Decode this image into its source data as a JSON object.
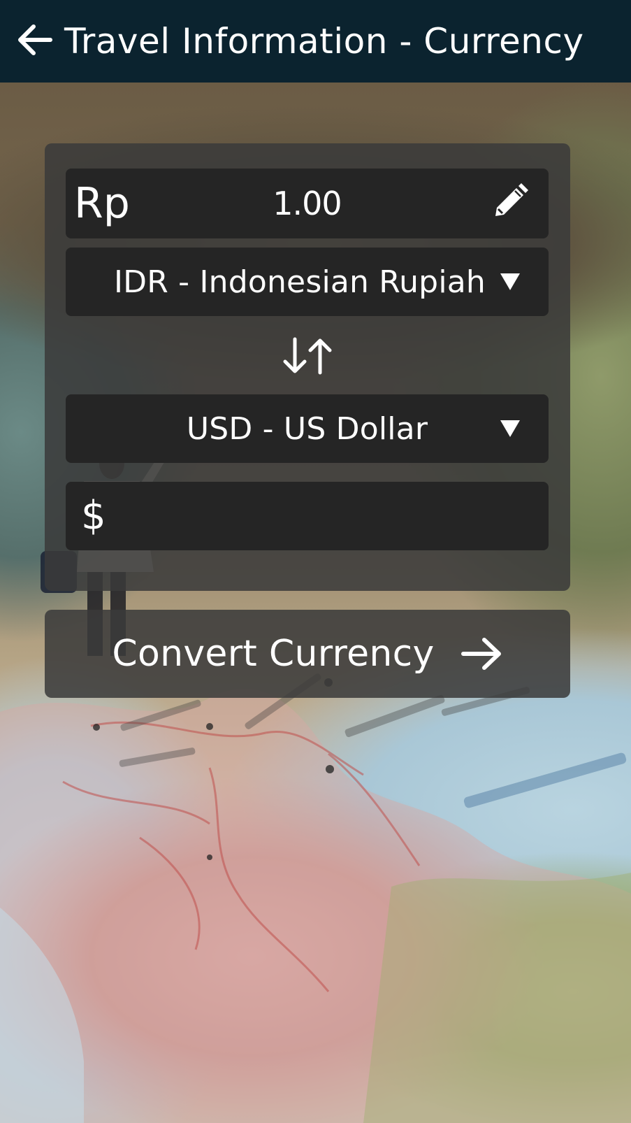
{
  "header": {
    "title": "Travel Information - Currency",
    "back_icon": "arrow-left-icon"
  },
  "converter": {
    "from": {
      "symbol": "Rp",
      "amount": "1.00",
      "currency_label": "IDR - Indonesian Rupiah",
      "edit_icon": "pencil-icon",
      "dropdown_icon": "triangle-down-icon"
    },
    "swap_icon": "swap-arrows-icon",
    "to": {
      "symbol": "$",
      "amount": "",
      "currency_label": "USD - US Dollar",
      "dropdown_icon": "triangle-down-icon"
    }
  },
  "convert_button": {
    "label": "Convert Currency",
    "icon": "arrow-right-icon"
  },
  "colors": {
    "app_bar": "#0b232f",
    "panel": "#3a3a3a",
    "field": "#252525",
    "text": "#ffffff"
  }
}
